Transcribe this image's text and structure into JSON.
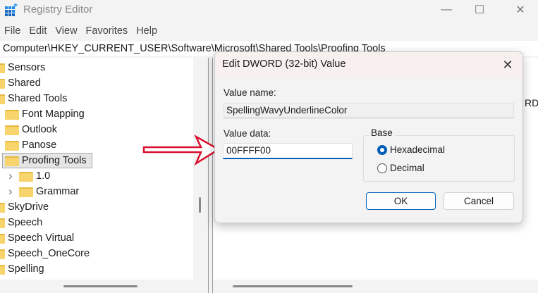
{
  "window": {
    "title": "Registry Editor",
    "minimize": "—",
    "maximize": "☐",
    "close": "✕"
  },
  "menu": [
    "File",
    "Edit",
    "View",
    "Favorites",
    "Help"
  ],
  "address": "Computer\\HKEY_CURRENT_USER\\Software\\Microsoft\\Shared Tools\\Proofing Tools",
  "tree": {
    "items": [
      {
        "label": "Sensors",
        "level": 0
      },
      {
        "label": "Shared",
        "level": 0
      },
      {
        "label": "Shared Tools",
        "level": 0
      },
      {
        "label": "Font Mapping",
        "level": 1
      },
      {
        "label": "Outlook",
        "level": 1
      },
      {
        "label": "Panose",
        "level": 1
      },
      {
        "label": "Proofing Tools",
        "level": 1,
        "selected": true
      },
      {
        "label": "1.0",
        "level": 2,
        "expandable": true
      },
      {
        "label": "Grammar",
        "level": 2,
        "expandable": true
      },
      {
        "label": "SkyDrive",
        "level": 0
      },
      {
        "label": "Speech",
        "level": 0
      },
      {
        "label": "Speech Virtual",
        "level": 0
      },
      {
        "label": "Speech_OneCore",
        "level": 0
      },
      {
        "label": "Spelling",
        "level": 0
      }
    ]
  },
  "right_pane": {
    "partial_text": "RD"
  },
  "dialog": {
    "title": "Edit DWORD (32-bit) Value",
    "close": "✕",
    "value_name_label": "Value name:",
    "value_name": "SpellingWavyUnderlineColor",
    "value_data_label": "Value data:",
    "value_data": "00FFFF00",
    "base_label": "Base",
    "base_options": [
      {
        "label": "Hexadecimal",
        "selected": true
      },
      {
        "label": "Decimal",
        "selected": false
      }
    ],
    "ok": "OK",
    "cancel": "Cancel"
  },
  "colors": {
    "accent": "#005fb8",
    "arrow": "#d9112f",
    "folder": "#f7d56c"
  }
}
